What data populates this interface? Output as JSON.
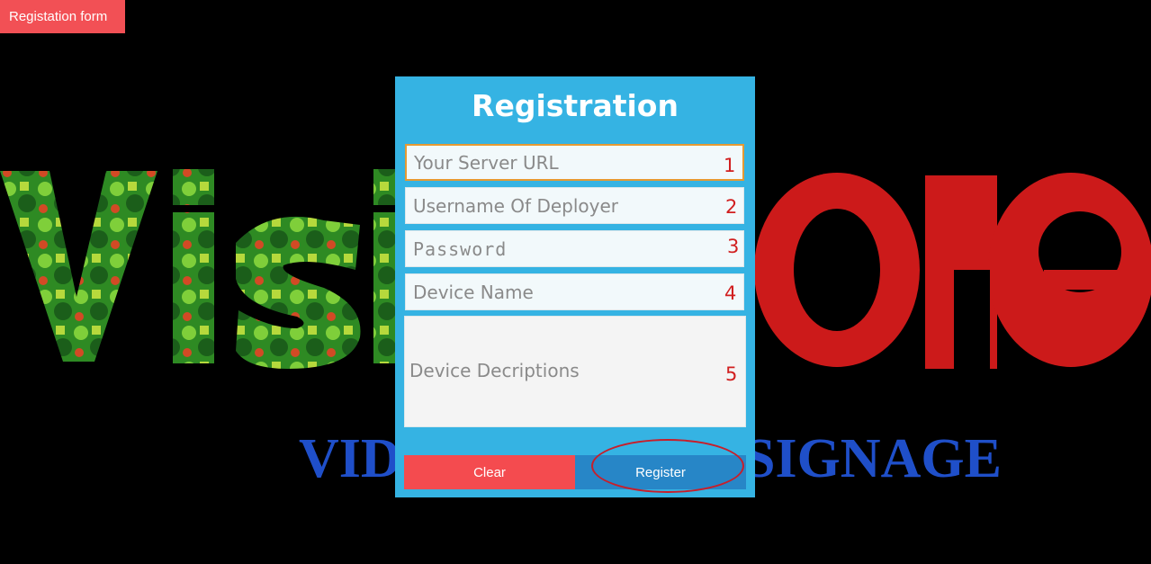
{
  "app": {
    "title": "Registation form"
  },
  "logo": {
    "word_left": "Visi",
    "word_right": "one",
    "tagline": "VIDEO DIGITAL SIGNAGE"
  },
  "form": {
    "title": "Registration",
    "fields": [
      {
        "placeholder": "Your Server URL",
        "value": "",
        "number": "1",
        "focused": true
      },
      {
        "placeholder": "Username Of Deployer",
        "value": "",
        "number": "2"
      },
      {
        "placeholder": "Password",
        "value": "",
        "number": "3"
      },
      {
        "placeholder": "Device Name",
        "value": "",
        "number": "4"
      },
      {
        "placeholder": "Device Decriptions",
        "value": "",
        "number": "5"
      }
    ],
    "buttons": {
      "clear": "Clear",
      "register": "Register"
    }
  },
  "colors": {
    "accent": "#35b3e3",
    "title_bar": "#f25055",
    "clear_button": "#f44b4f",
    "register_button": "#2786c7",
    "annotation": "#d11f1f",
    "logo_red": "#cc1a1a",
    "logo_blue": "#1f4fc9"
  }
}
